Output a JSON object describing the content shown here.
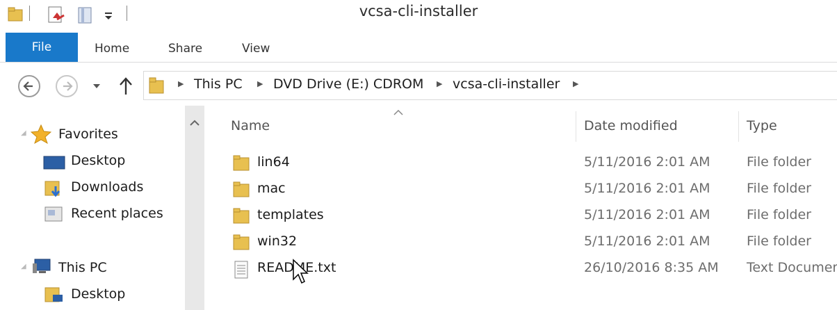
{
  "window": {
    "title": "vcsa-cli-installer"
  },
  "ribbon": {
    "tabs": [
      "File",
      "Home",
      "Share",
      "View"
    ]
  },
  "address": {
    "crumbs": [
      "This PC",
      "DVD Drive (E:) CDROM",
      "vcsa-cli-installer"
    ]
  },
  "nav": {
    "favorites": "Favorites",
    "items": [
      "Desktop",
      "Downloads",
      "Recent places"
    ],
    "this_pc": "This PC",
    "pc_items": [
      "Desktop"
    ]
  },
  "columns": {
    "name": "Name",
    "date": "Date modified",
    "type": "Type"
  },
  "files": [
    {
      "name": "lin64",
      "date": "5/11/2016 2:01 AM",
      "type": "File folder",
      "icon": "folder-icon"
    },
    {
      "name": "mac",
      "date": "5/11/2016 2:01 AM",
      "type": "File folder",
      "icon": "folder-icon"
    },
    {
      "name": "templates",
      "date": "5/11/2016 2:01 AM",
      "type": "File folder",
      "icon": "folder-icon"
    },
    {
      "name": "win32",
      "date": "5/11/2016 2:01 AM",
      "type": "File folder",
      "icon": "folder-icon"
    },
    {
      "name": "README.txt",
      "date": "26/10/2016 8:35 AM",
      "type": "Text Documen",
      "icon": "text-file-icon"
    }
  ],
  "colors": {
    "accent": "#1979ca",
    "folder": "#e8c050"
  }
}
